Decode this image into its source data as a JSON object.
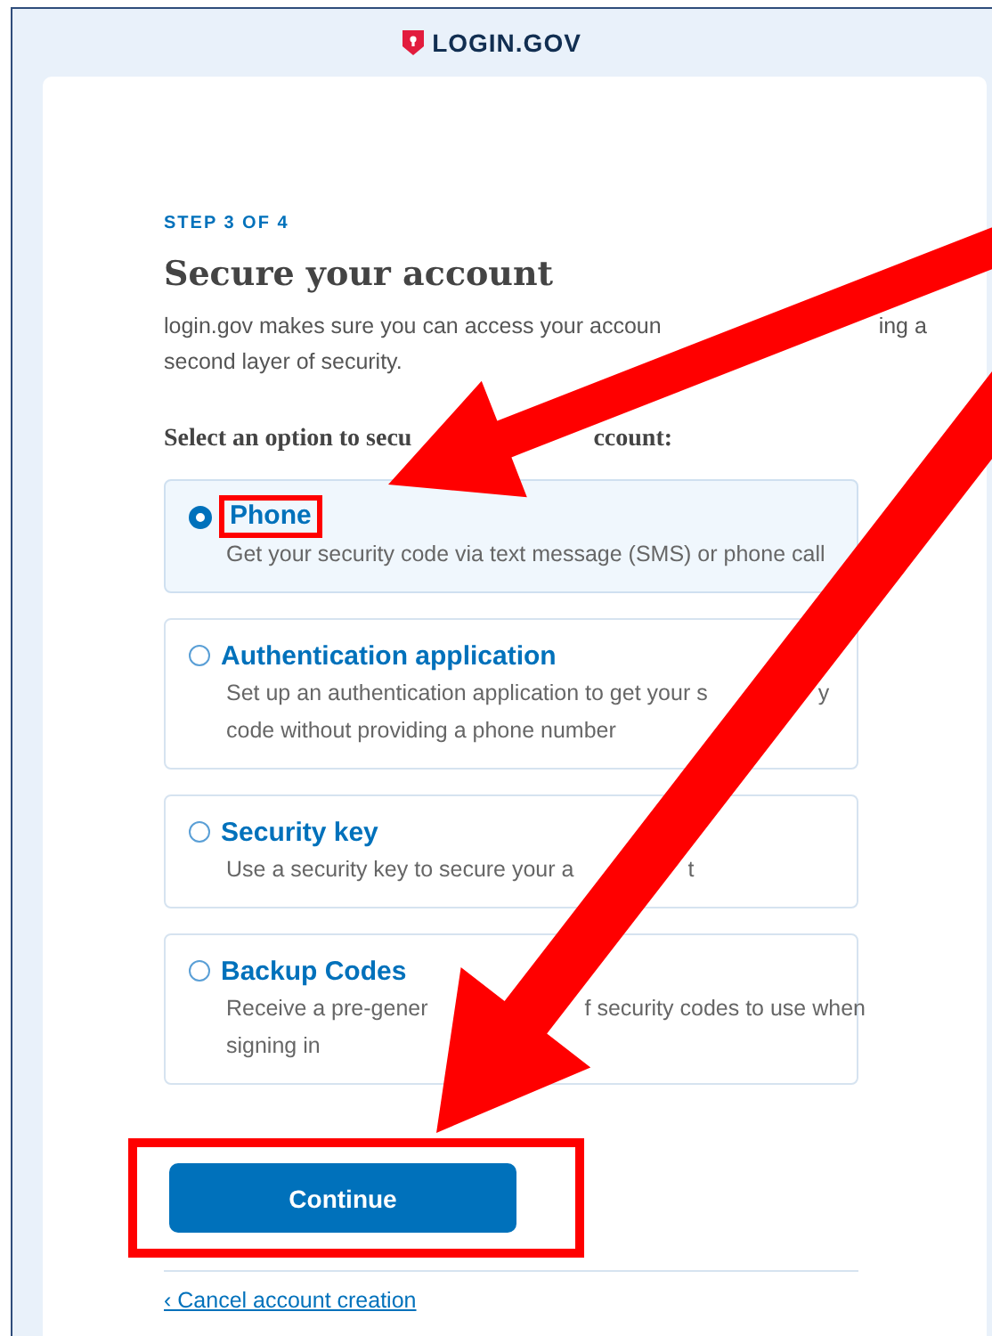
{
  "logo": {
    "text": "LOGIN.GOV"
  },
  "step": "STEP 3 OF 4",
  "title": "Secure your account",
  "description_lines": [
    [
      "login.gov makes sure you can access your accoun",
      "ing a"
    ],
    [
      "second layer of security."
    ]
  ],
  "prompt": [
    "Select an option to secu",
    "ccount:"
  ],
  "options": [
    {
      "title": "Phone",
      "selected": true,
      "highlighted": true,
      "description_lines": [
        [
          "Get your security code via text message (SMS) or phone call"
        ]
      ]
    },
    {
      "title": "Authentication application",
      "selected": false,
      "highlighted": false,
      "description_lines": [
        [
          "Set up an authentication application to get your s",
          "y"
        ],
        [
          "code without providing a phone number"
        ]
      ]
    },
    {
      "title": "Security key",
      "selected": false,
      "highlighted": false,
      "description_lines": [
        [
          "Use a security key to secure your a",
          "t"
        ]
      ]
    },
    {
      "title": "Backup Codes",
      "selected": false,
      "highlighted": false,
      "description_lines": [
        [
          "Receive a pre-gener",
          "f security codes to use when"
        ],
        [
          "signing in"
        ]
      ]
    }
  ],
  "continue_button": {
    "label": "Continue",
    "highlighted": true
  },
  "cancel_link": "‹ Cancel account creation"
}
